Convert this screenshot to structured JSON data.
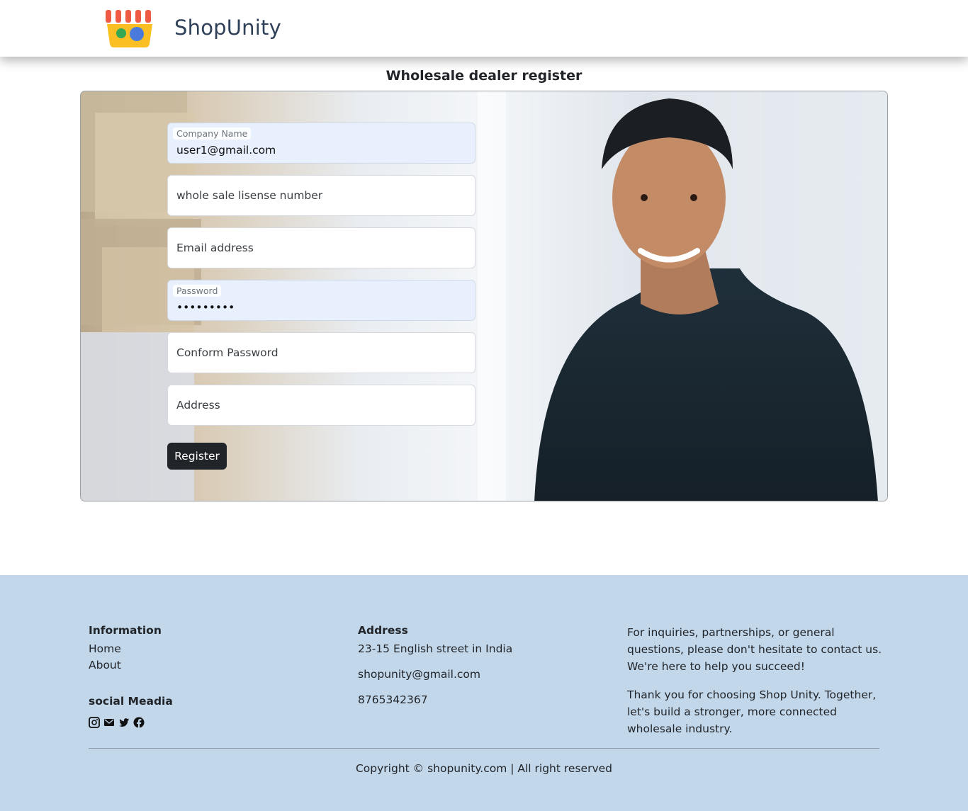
{
  "header": {
    "brand": "ShopUnity",
    "logo_icon": "storefront-icon"
  },
  "page": {
    "title": "Wholesale dealer register"
  },
  "form": {
    "company_name": {
      "label": "Company Name",
      "value": "user1@gmail.com"
    },
    "license_number": {
      "placeholder": "whole sale lisense number"
    },
    "email": {
      "placeholder": "Email address"
    },
    "password": {
      "label": "Password",
      "value": "•••••••••"
    },
    "confirm_password": {
      "placeholder": "Conform Password"
    },
    "address": {
      "placeholder": "Address"
    },
    "submit_label": "Register"
  },
  "footer": {
    "information": {
      "heading": "Information",
      "links": [
        "Home",
        "About"
      ]
    },
    "social": {
      "heading": "social Meadia",
      "icons": [
        "instagram-icon",
        "email-icon",
        "twitter-icon",
        "facebook-icon"
      ]
    },
    "address": {
      "heading": "Address",
      "street": "23-15 English street in India",
      "email": "shopunity@gmail.com",
      "phone": "8765342367"
    },
    "about": {
      "para1": "For inquiries, partnerships, or general questions, please don't hesitate to contact us. We're here to help you succeed!",
      "para2": "Thank you for choosing Shop Unity. Together, let's build a stronger, more connected wholesale industry."
    },
    "copyright": "Copyright © shopunity.com | All right reserved"
  },
  "colors": {
    "brand_text": "#2f4159",
    "button": "#212529",
    "footer_bg": "#c3d7eb",
    "autofill_bg": "#e8f0fe"
  }
}
